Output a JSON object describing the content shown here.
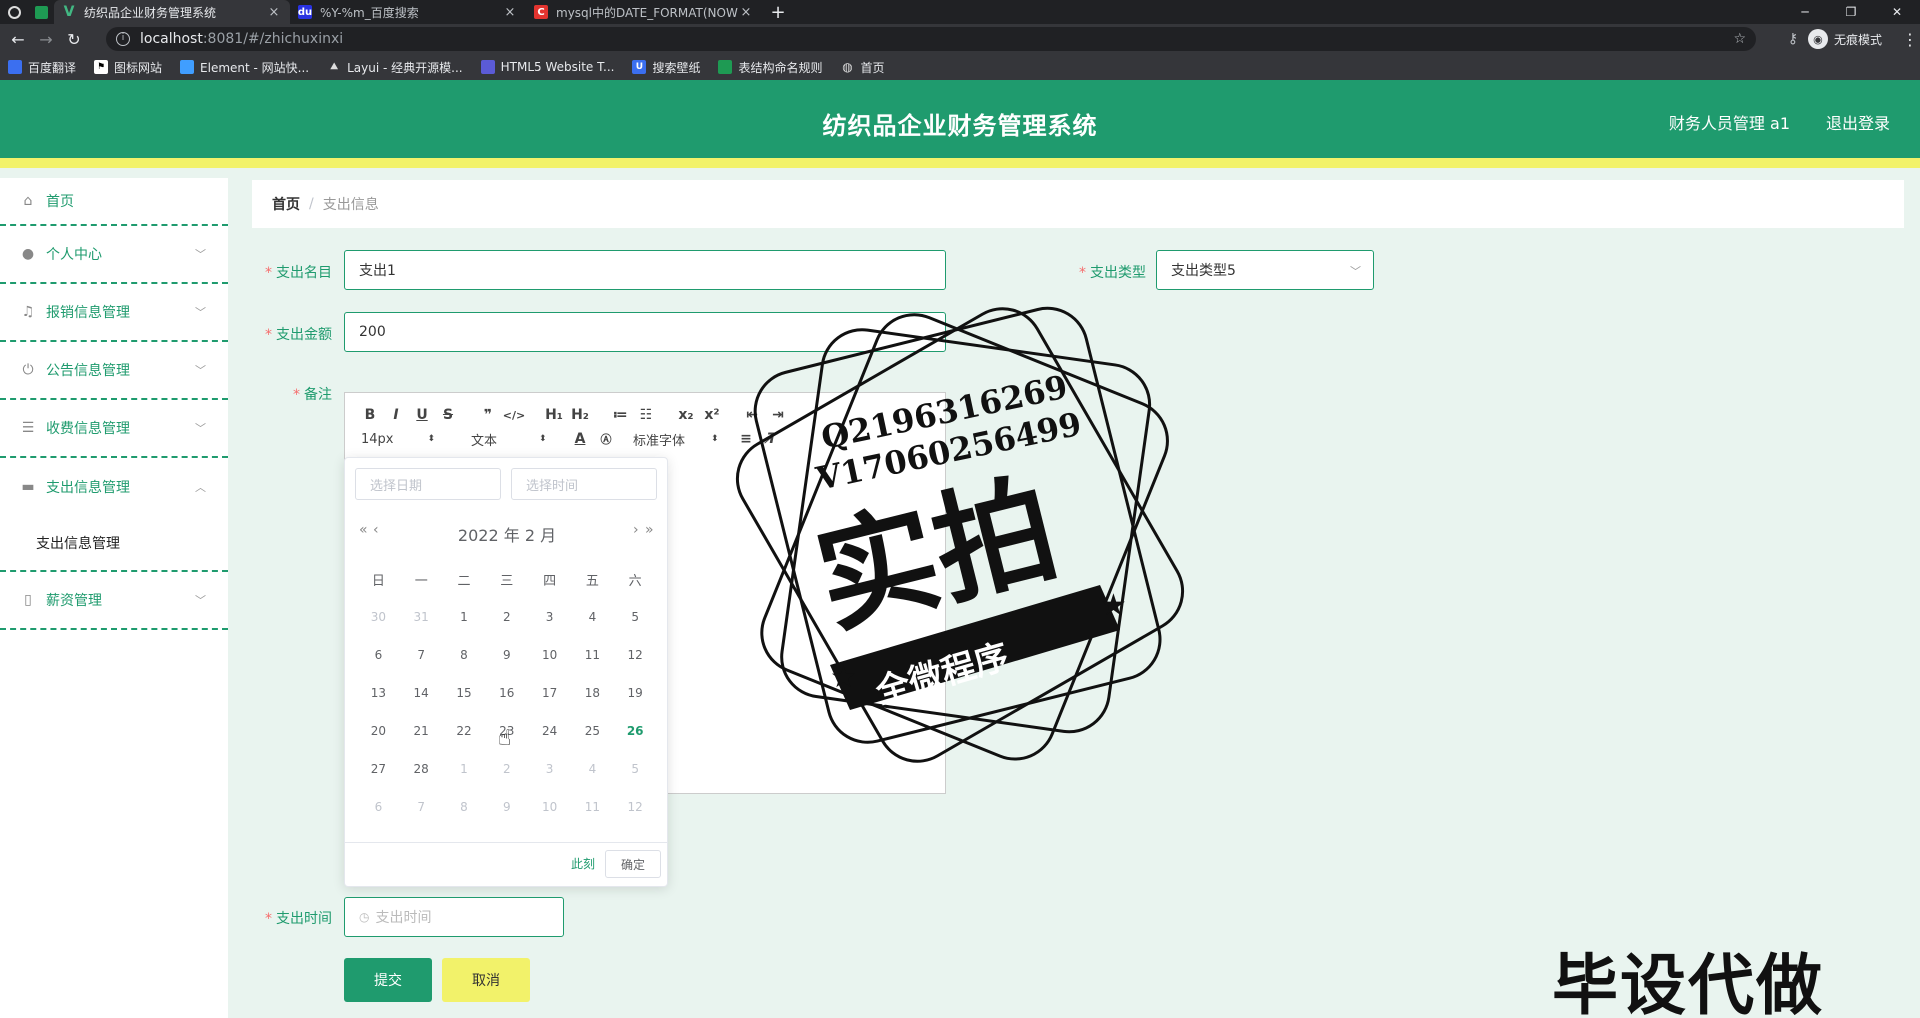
{
  "browser": {
    "tabs": [
      {
        "title": "纺织品企业财务管理系统",
        "favicon": "V",
        "color": "#42b883"
      },
      {
        "title": "%Y-%m_百度搜索",
        "favicon": "du",
        "color": "#2932e1"
      },
      {
        "title": "mysql中的DATE_FORMAT(NOW",
        "favicon": "C",
        "color": "#e3342f"
      }
    ],
    "tab_close": "×",
    "new_tab": "+",
    "url_host": "localhost",
    "url_path": ":8081/#/zhichuxinxi",
    "incognito_label": "无痕模式",
    "bookmarks": [
      {
        "label": "百度翻译",
        "color": "#3b6ff0"
      },
      {
        "label": "图标网站",
        "color": "#222222"
      },
      {
        "label": "Element - 网站快...",
        "color": "#409eff"
      },
      {
        "label": "Layui - 经典开源模...",
        "color": "#555555"
      },
      {
        "label": "HTML5 Website T...",
        "color": "#5b5bd6"
      },
      {
        "label": "搜索壁纸",
        "color": "#3b6ff0"
      },
      {
        "label": "表结构命名规则",
        "color": "#1e9a53"
      },
      {
        "label": "首页",
        "color": "#999999"
      }
    ]
  },
  "header": {
    "title": "纺织品企业财务管理系统",
    "user": "财务人员管理 a1",
    "logout": "退出登录"
  },
  "sidebar": {
    "items": [
      {
        "label": "首页",
        "icon": "home-icon",
        "glyph": "⌂"
      },
      {
        "label": "个人中心",
        "icon": "user-icon",
        "glyph": "●"
      },
      {
        "label": "报销信息管理",
        "icon": "bell-icon",
        "glyph": "♫"
      },
      {
        "label": "公告信息管理",
        "icon": "power-icon",
        "glyph": "⏻"
      },
      {
        "label": "收费信息管理",
        "icon": "menu-icon",
        "glyph": "☰"
      },
      {
        "label": "支出信息管理",
        "icon": "briefcase-icon",
        "glyph": "▬"
      },
      {
        "label": "薪资管理",
        "icon": "phone-icon",
        "glyph": "▯"
      }
    ],
    "sub_item": "支出信息管理"
  },
  "breadcrumb": {
    "home": "首页",
    "separator": "/",
    "current": "支出信息"
  },
  "form": {
    "name_label": "支出名目",
    "name_value": "支出1",
    "type_label": "支出类型",
    "type_value": "支出类型5",
    "amount_label": "支出金额",
    "amount_value": "200",
    "remark_label": "备注",
    "time_label": "支出时间",
    "time_placeholder": "支出时间",
    "submit": "提交",
    "cancel": "取消"
  },
  "editor": {
    "row1": [
      "B",
      "I",
      "U",
      "S",
      "❞",
      "</>",
      "H₁",
      "H₂",
      "≔",
      "☷",
      "x₂",
      "x²",
      "⇤",
      "⇥"
    ],
    "font_size": "14px",
    "text_style": "文本",
    "font_family": "标准字体"
  },
  "datepicker": {
    "date_placeholder": "选择日期",
    "time_placeholder": "选择时间",
    "header_year": "2022 年",
    "header_month": "2 月",
    "weekdays": [
      "日",
      "一",
      "二",
      "三",
      "四",
      "五",
      "六"
    ],
    "rows": [
      [
        "30",
        "31",
        "1",
        "2",
        "3",
        "4",
        "5"
      ],
      [
        "6",
        "7",
        "8",
        "9",
        "10",
        "11",
        "12"
      ],
      [
        "13",
        "14",
        "15",
        "16",
        "17",
        "18",
        "19"
      ],
      [
        "20",
        "21",
        "22",
        "23",
        "24",
        "25",
        "26"
      ],
      [
        "27",
        "28",
        "1",
        "2",
        "3",
        "4",
        "5"
      ],
      [
        "6",
        "7",
        "8",
        "9",
        "10",
        "11",
        "12"
      ]
    ],
    "now": "此刻",
    "ok": "确定"
  },
  "overlay": {
    "stamp_line1": "Q2196316269",
    "stamp_line2": "V17060256499",
    "stamp_big": "实拍",
    "stamp_ribbon": "全微程序",
    "watermark": "毕设代做"
  }
}
